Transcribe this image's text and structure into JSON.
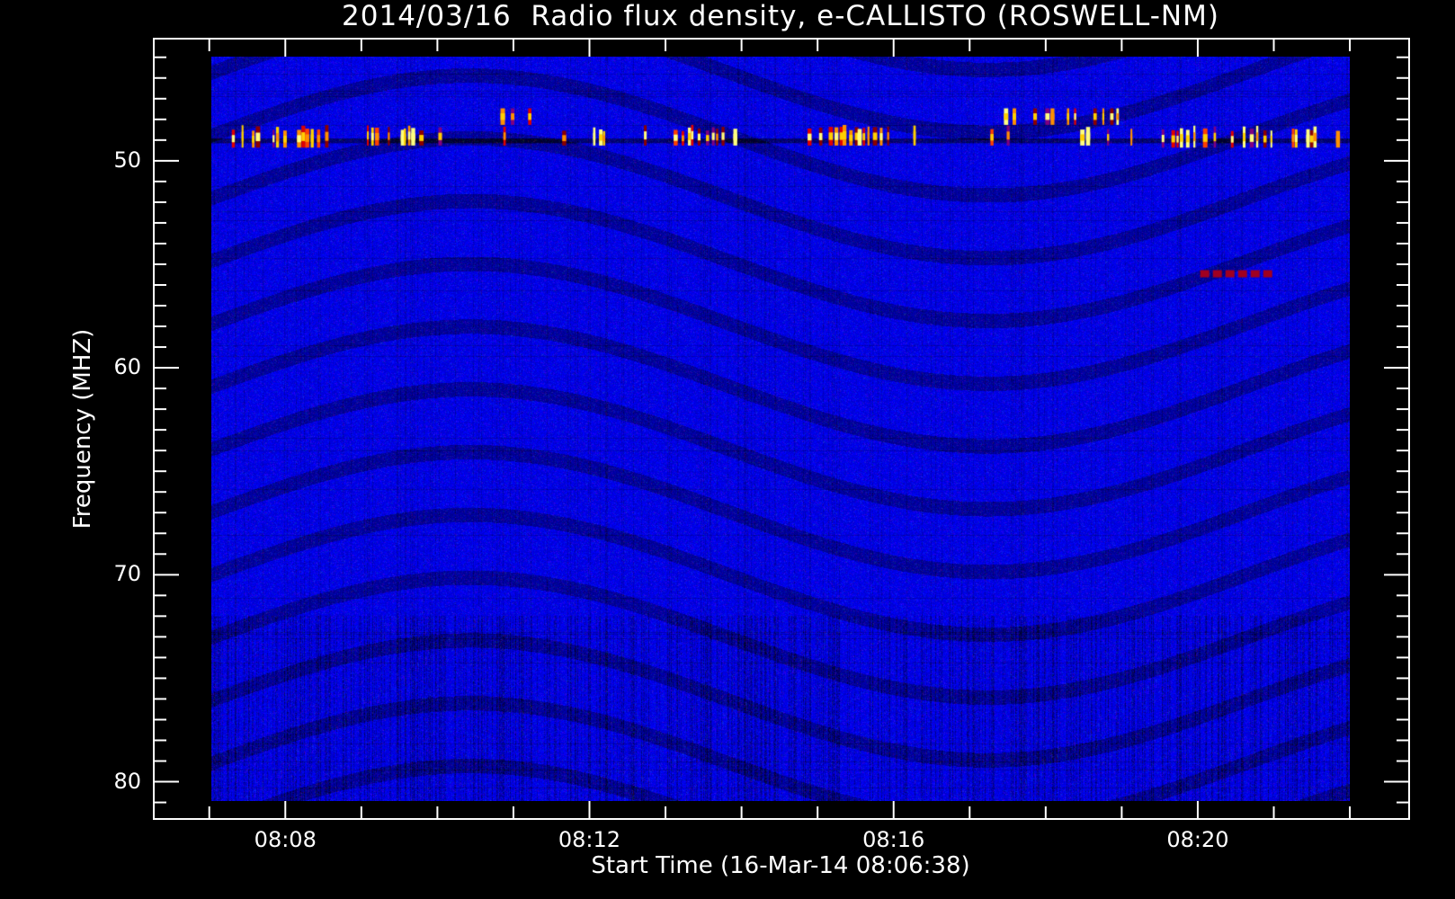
{
  "chart_data": {
    "type": "heatmap",
    "title": "2014/03/16  Radio flux density, e-CALLISTO (ROSWELL-NM)",
    "xlabel": "Start Time (16-Mar-14 08:06:38)",
    "ylabel": "Frequency (MHZ)",
    "x_ticks": [
      "08:08",
      "08:12",
      "08:16",
      "08:20"
    ],
    "x_tick_minutes": [
      68,
      72,
      76,
      80
    ],
    "x_minor_step_min": 1,
    "xlim_minutes_after_0700": [
      66.27,
      82.78
    ],
    "data_time_range_minutes_after_0700": [
      67.0,
      82.0
    ],
    "y_ticks": [
      "50",
      "60",
      "70",
      "80"
    ],
    "y_tick_values": [
      50,
      60,
      70,
      80
    ],
    "y_minor_step": 1,
    "ylim": [
      44.1,
      81.8
    ],
    "data_freq_range": [
      45,
      81
    ],
    "y_inverted": true,
    "colormap": "blue-red-yellow (hot)",
    "bursts": [
      {
        "t_start": 0.27,
        "t_end": 1.55,
        "freq_low": 47.5,
        "freq_high": 49.4,
        "upper": false
      },
      {
        "t_start": 2.05,
        "t_end": 3.08,
        "freq_low": 47.8,
        "freq_high": 49.3,
        "upper": false
      },
      {
        "t_start": 3.81,
        "t_end": 4.73,
        "freq_low": 47.5,
        "freq_high": 49.3,
        "upper": true
      },
      {
        "t_start": 5.03,
        "t_end": 5.34,
        "freq_low": 48.3,
        "freq_high": 49.3,
        "upper": false
      },
      {
        "t_start": 5.7,
        "t_end": 6.99,
        "freq_low": 47.8,
        "freq_high": 49.3,
        "upper": false
      },
      {
        "t_start": 7.72,
        "t_end": 9.31,
        "freq_low": 47.8,
        "freq_high": 49.3,
        "upper": false
      },
      {
        "t_start": 10.22,
        "t_end": 12.12,
        "freq_low": 47.3,
        "freq_high": 49.3,
        "upper": true
      },
      {
        "t_start": 12.36,
        "t_end": 14.98,
        "freq_low": 47.5,
        "freq_high": 49.4,
        "upper": false
      }
    ],
    "weak_patches": [
      {
        "t_start": 13.03,
        "t_end": 13.95,
        "freq": 55.5
      }
    ],
    "grid": false
  }
}
